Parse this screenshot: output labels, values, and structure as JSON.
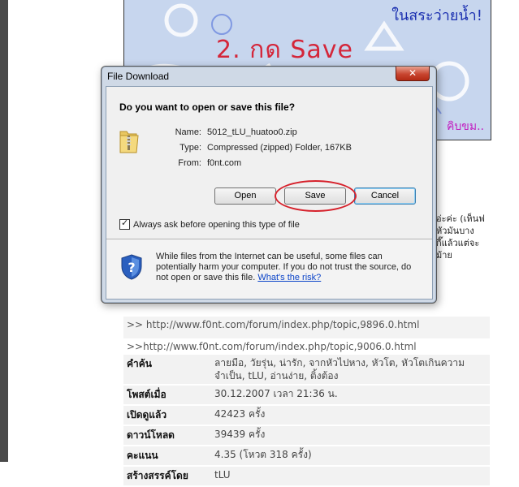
{
  "background": {
    "banner_caption": "2. กด Save",
    "banner_text_top_right": "ในสระว่ายน้ำ!",
    "banner_text_bottom_right": "คิบขม..",
    "side_text": [
      "อ่ะค่ะ (เห็นฟ",
      "หัวมันบาง",
      "กี๊แล้วแต่จะ",
      "ม้าย"
    ],
    "links": [
      ">> http://www.f0nt.com/forum/index.php/topic,9896.0.html",
      ">>http://www.f0nt.com/forum/index.php/topic,9006.0.html"
    ],
    "info": [
      {
        "label": "คำค้น",
        "value": "ลายมือ, วัยรุ่น, น่ารัก, จากหัวไปหาง, หัวโต, หัวโตเกินความจำเป็น, tLU, อ่านง่าย, ติ้งต้อง"
      },
      {
        "label": "โพสต์เมื่อ",
        "value": "30.12.2007 เวลา 21:36 น."
      },
      {
        "label": "เปิดดูแล้ว",
        "value": "42423 ครั้ง"
      },
      {
        "label": "ดาวน์โหลด",
        "value": "39439 ครั้ง"
      },
      {
        "label": "คะแนน",
        "value": "4.35 (โหวต 318 ครั้ง)"
      },
      {
        "label": "สร้างสรรค์โดย",
        "value": "tLU"
      }
    ]
  },
  "dialog": {
    "title": "File Download",
    "close_icon": "close-icon",
    "question": "Do you want to open or save this file?",
    "file_icon": "zip-folder-icon",
    "fields": {
      "name_label": "Name:",
      "name_value": "5012_tLU_huatoo0.zip",
      "type_label": "Type:",
      "type_value": "Compressed (zipped) Folder, 167KB",
      "from_label": "From:",
      "from_value": "f0nt.com"
    },
    "buttons": {
      "open": "Open",
      "save": "Save",
      "cancel": "Cancel"
    },
    "checkbox": {
      "label": "Always ask before opening this type of file",
      "checked": true
    },
    "warning": {
      "icon": "shield-icon",
      "text": "While files from the Internet can be useful, some files can potentially harm your computer. If you do not trust the source, do not open or save this file.",
      "link": "What's the risk?"
    }
  }
}
